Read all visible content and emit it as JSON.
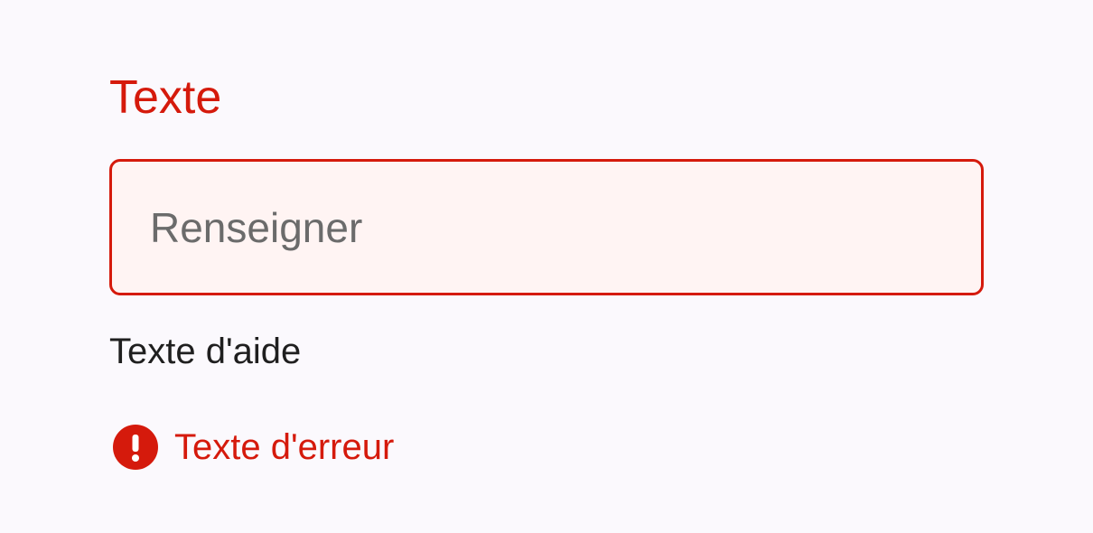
{
  "field": {
    "label": "Texte",
    "placeholder": "Renseigner",
    "value": "",
    "help_text": "Texte d'aide",
    "error_text": "Texte d'erreur",
    "error_icon": "error-exclamation-icon"
  },
  "colors": {
    "error": "#d51a0c",
    "input_background": "#fff4f3",
    "page_background": "#fbf9fd",
    "placeholder": "#6b6b6b",
    "help_text": "#1f1f1f"
  }
}
